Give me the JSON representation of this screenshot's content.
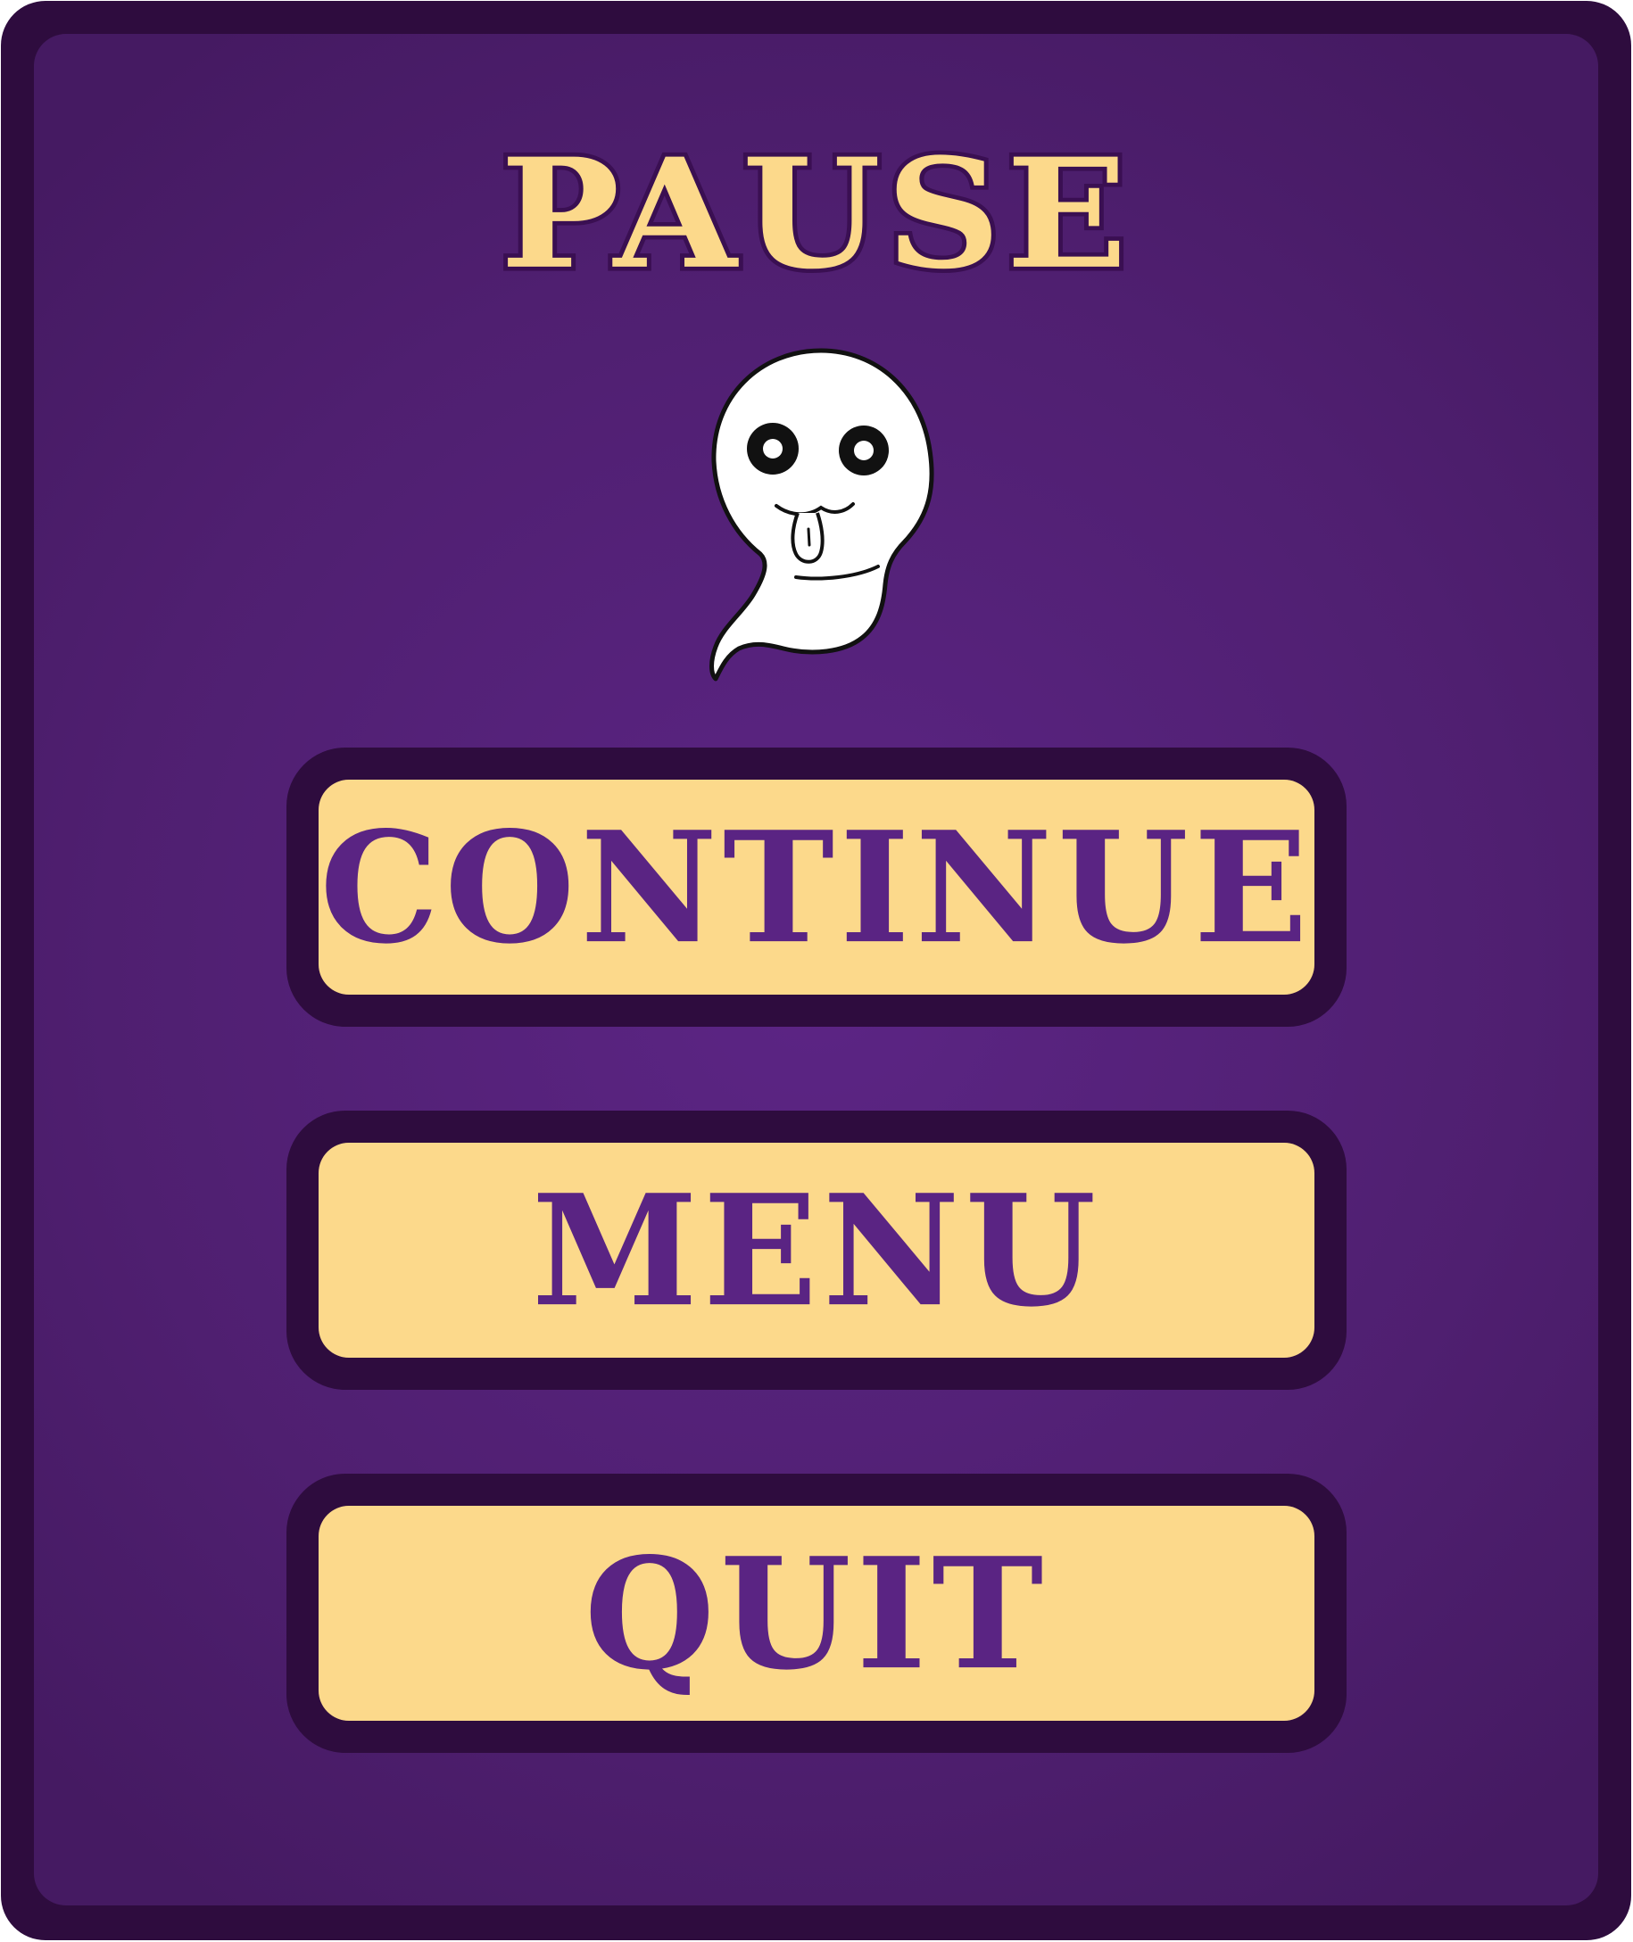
{
  "pause_menu": {
    "title": "PAUSE",
    "mascot_icon": "ghost-icon",
    "buttons": {
      "continue_label": "CONTINUE",
      "menu_label": "MENU",
      "quit_label": "QUIT"
    }
  },
  "colors": {
    "panel_border": "#2e0c3e",
    "panel_background": "#55207a",
    "button_fill": "#fcd98b",
    "button_text": "#5a2483",
    "title_text": "#fcd98b"
  }
}
